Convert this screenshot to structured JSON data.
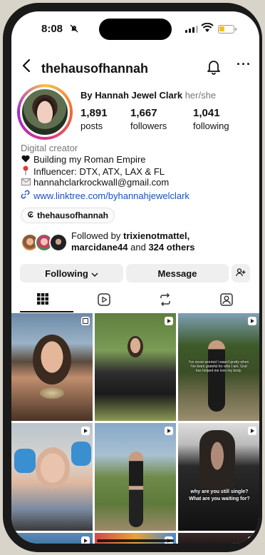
{
  "status_bar": {
    "time": "8:08",
    "mute_icon": "bell-slash-icon",
    "battery_color": "#f0c21b"
  },
  "header": {
    "username": "thehausofhannah"
  },
  "profile": {
    "full_name": "By Hannah Jewel Clark",
    "pronouns": "her/she",
    "stats": [
      {
        "number": "1,891",
        "label": "posts"
      },
      {
        "number": "1,667",
        "label": "followers"
      },
      {
        "number": "1,041",
        "label": "following"
      }
    ],
    "category": "Digital creator",
    "bio": [
      {
        "icon": "black-heart-icon",
        "text": "Building my Roman Empire"
      },
      {
        "icon": "pin-icon",
        "text": "Influencer: DTX, ATX, LAX & FL"
      },
      {
        "icon": "envelope-icon",
        "text": "hannahclarkrockwall@gmail.com"
      }
    ],
    "link": "www.linktree.com/byhannahjewelclark",
    "threads_handle": "thehausofhannah",
    "link_color": "#1b4dc7"
  },
  "followed_by": {
    "prefix": "Followed by",
    "user1": "trixienotmattel,",
    "user2": "marcidane44",
    "middle": "and",
    "others": "324 others"
  },
  "actions": {
    "following_label": "Following",
    "message_label": "Message"
  },
  "grid": {
    "captions": {
      "post3": "I've never worried I wasn't pretty when I've been grateful for who I am. God has helped me love my body.",
      "post6_line1": "why are you still single?",
      "post6_line2": "What are you waiting for?"
    }
  }
}
